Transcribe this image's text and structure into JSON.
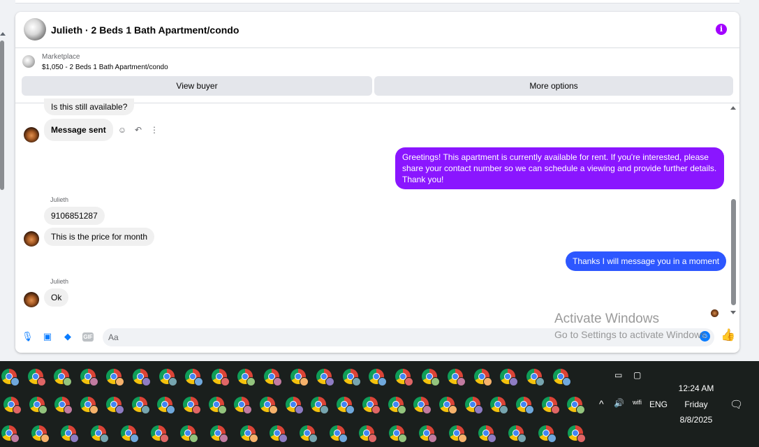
{
  "header": {
    "title": "Julieth · 2 Beds 1 Bath Apartment/condo",
    "info_icon": "i"
  },
  "listing": {
    "source": "Marketplace",
    "price_title": "$1,050 - 2 Beds 1 Bath Apartment/condo",
    "view_buyer_label": "View buyer",
    "more_options_label": "More options"
  },
  "messages": {
    "incoming_1": "Is this still available?",
    "incoming_2": "Message sent",
    "outgoing_1": "Greetings! This apartment is currently available for rent. If you're interested, please share your contact number so we can schedule a viewing and provide further details. Thank you!",
    "sender_1": "Julieth",
    "incoming_3": "9106851287",
    "incoming_4": "This is the price for month",
    "outgoing_2": "Thanks I will message you in a moment",
    "sender_2": "Julieth",
    "incoming_5": "Ok"
  },
  "message_tools": {
    "react_icon": "☺",
    "reply_icon": "↶",
    "more_icon": "⋮"
  },
  "composer": {
    "placeholder": "Aa",
    "gif_label": "GIF",
    "mic_icon": "🎙",
    "photo_icon": "▣",
    "sticker_icon": "◆",
    "emoji_icon": "☺",
    "like_icon": "👍"
  },
  "watermark": {
    "line1": "Activate Windows",
    "line2": "Go to Settings to activate Windows."
  },
  "taskbar": {
    "language": "ENG",
    "time": "12:24 AM",
    "day": "Friday",
    "date": "8/8/2025",
    "chevron_icon": "^",
    "volume_icon": "🔊",
    "wifi_icon": "wifi",
    "notification_icon": "🗨"
  },
  "colors": {
    "outgoing_purple": "#8a16ff",
    "outgoing_blue": "#2d57ff",
    "messenger_blue": "#0a7cff",
    "info_purple": "#a200ff"
  }
}
